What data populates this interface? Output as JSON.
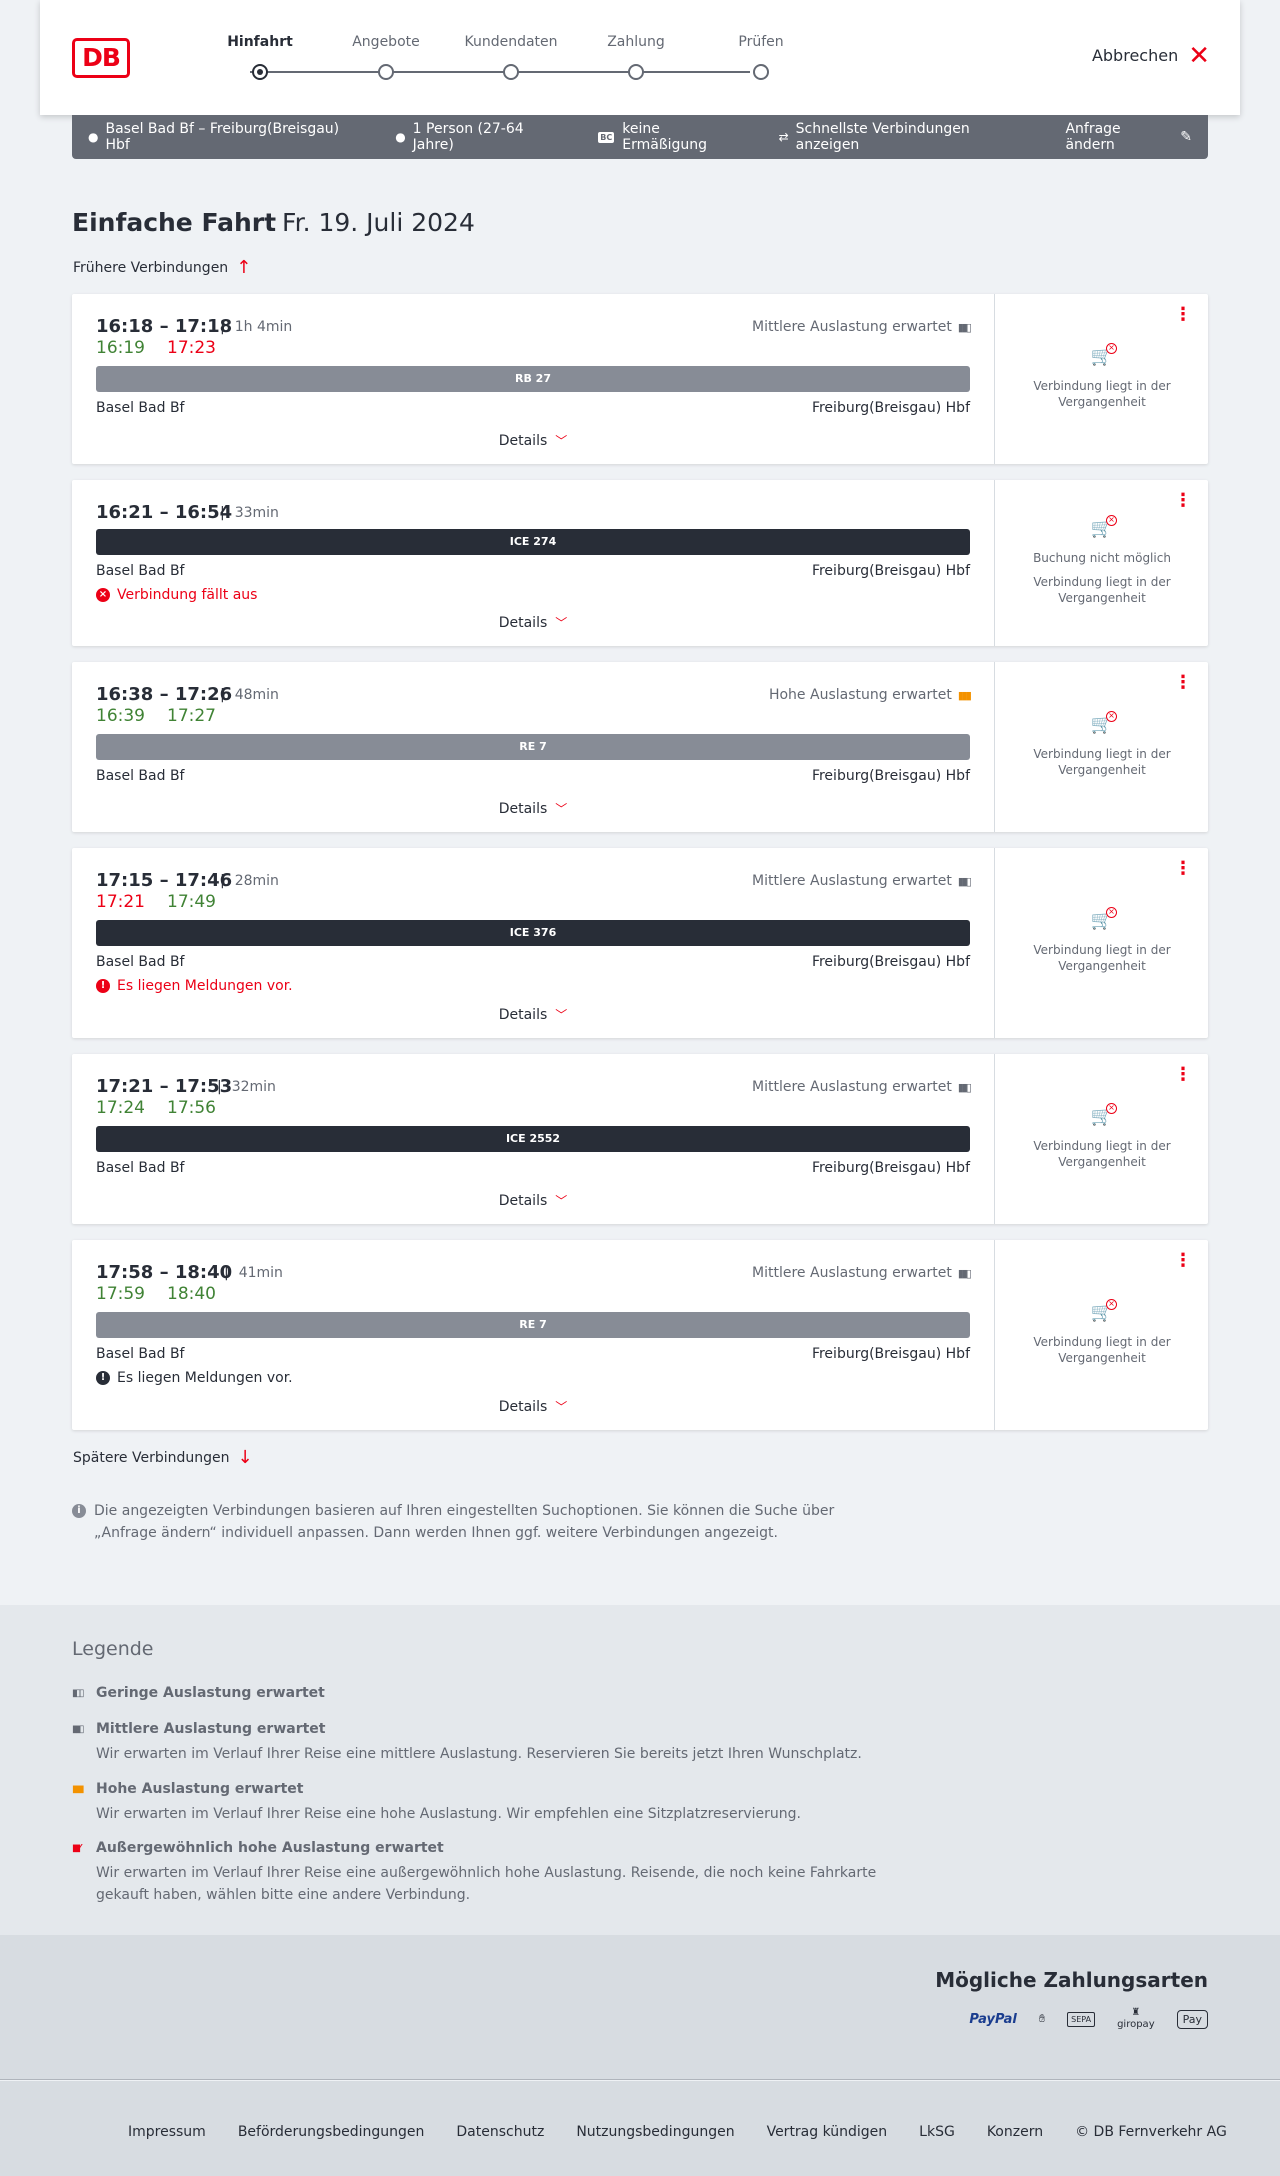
{
  "header": {
    "logo": "DB",
    "steps": [
      {
        "label": "Hinfahrt",
        "active": true
      },
      {
        "label": "Angebote",
        "active": false
      },
      {
        "label": "Kundendaten",
        "active": false
      },
      {
        "label": "Zahlung",
        "active": false
      },
      {
        "label": "Prüfen",
        "active": false
      }
    ],
    "cancel_label": "Abbrechen"
  },
  "searchbar": {
    "route": "Basel Bad Bf – Freiburg(Breisgau) Hbf",
    "travellers": "1 Person (27-64 Jahre)",
    "discount_badge": "BC",
    "discount": "keine Ermäßigung",
    "option": "Schnellste Verbindungen anzeigen",
    "edit_label": "Anfrage ändern"
  },
  "title": {
    "main": "Einfache Fahrt",
    "date": "Fr. 19. Juli 2024"
  },
  "earlier_label": "Frühere Verbindungen",
  "later_label": "Spätere Verbindungen",
  "connections": [
    {
      "times": "16:18 – 17:18",
      "duration": "1h 4min",
      "rt_dep": "16:19",
      "rt_dep_color": "green",
      "rt_arr": "17:23",
      "rt_arr_color": "red",
      "load": "Mittlere Auslastung erwartet",
      "load_level": "medium",
      "train": "RB 27",
      "train_style": "grey",
      "from": "Basel Bad Bf",
      "to": "Freiburg(Breisgau) Hbf",
      "message": "",
      "details": "Details",
      "side": [
        "Verbindung liegt in der Vergangenheit"
      ]
    },
    {
      "times": "16:21 – 16:54",
      "duration": "33min",
      "rt_dep": "",
      "rt_arr": "",
      "load": "",
      "load_level": "",
      "train": "ICE 274",
      "train_style": "dark",
      "from": "Basel Bad Bf",
      "to": "Freiburg(Breisgau) Hbf",
      "message": "Verbindung fällt aus",
      "message_style": "red-x",
      "details": "Details",
      "side": [
        "Buchung nicht möglich",
        "Verbindung liegt in der Vergangenheit"
      ]
    },
    {
      "times": "16:38 – 17:26",
      "duration": "48min",
      "rt_dep": "16:39",
      "rt_dep_color": "green",
      "rt_arr": "17:27",
      "rt_arr_color": "green",
      "load": "Hohe Auslastung erwartet",
      "load_level": "high",
      "train": "RE 7",
      "train_style": "grey",
      "from": "Basel Bad Bf",
      "to": "Freiburg(Breisgau) Hbf",
      "message": "",
      "details": "Details",
      "side": [
        "Verbindung liegt in der Vergangenheit"
      ]
    },
    {
      "times": "17:15 – 17:46",
      "duration": "28min",
      "rt_dep": "17:21",
      "rt_dep_color": "red",
      "rt_arr": "17:49",
      "rt_arr_color": "green",
      "load": "Mittlere Auslastung erwartet",
      "load_level": "medium",
      "train": "ICE 376",
      "train_style": "dark",
      "from": "Basel Bad Bf",
      "to": "Freiburg(Breisgau) Hbf",
      "message": "Es liegen Meldungen vor.",
      "message_style": "red-excl",
      "details": "Details",
      "side": [
        "Verbindung liegt in der Vergangenheit"
      ]
    },
    {
      "times": "17:21 – 17:53",
      "duration": "32min",
      "rt_dep": "17:24",
      "rt_dep_color": "green",
      "rt_arr": "17:56",
      "rt_arr_color": "green",
      "load": "Mittlere Auslastung erwartet",
      "load_level": "medium",
      "train": "ICE 2552",
      "train_style": "dark",
      "from": "Basel Bad Bf",
      "to": "Freiburg(Breisgau) Hbf",
      "message": "",
      "details": "Details",
      "side": [
        "Verbindung liegt in der Vergangenheit"
      ]
    },
    {
      "times": "17:58 – 18:40",
      "duration": "41min",
      "rt_dep": "17:59",
      "rt_dep_color": "green",
      "rt_arr": "18:40",
      "rt_arr_color": "green",
      "load": "Mittlere Auslastung erwartet",
      "load_level": "medium",
      "train": "RE 7",
      "train_style": "grey",
      "from": "Basel Bad Bf",
      "to": "Freiburg(Breisgau) Hbf",
      "message": "Es liegen Meldungen vor.",
      "message_style": "black-excl",
      "details": "Details",
      "side": [
        "Verbindung liegt in der Vergangenheit"
      ]
    }
  ],
  "info_text": "Die angezeigten Verbindungen basieren auf Ihren eingestellten Suchoptionen. Sie können die Suche über „Anfrage ändern“ individuell anpassen. Dann werden Ihnen ggf. weitere Verbindungen angezeigt.",
  "legend": {
    "title": "Legende",
    "items": [
      {
        "label": "Geringe Auslastung erwartet",
        "desc": "",
        "level": "low"
      },
      {
        "label": "Mittlere Auslastung erwartet",
        "desc": "Wir erwarten im Verlauf Ihrer Reise eine mittlere Auslastung. Reservieren Sie bereits jetzt Ihren Wunschplatz.",
        "level": "medium"
      },
      {
        "label": "Hohe Auslastung erwartet",
        "desc": "Wir erwarten im Verlauf Ihrer Reise eine hohe Auslastung. Wir empfehlen eine Sitzplatzreservierung.",
        "level": "high"
      },
      {
        "label": "Außergewöhnlich hohe Auslastung erwartet",
        "desc": "Wir erwarten im Verlauf Ihrer Reise eine außergewöhnlich hohe Auslastung. Reisende, die noch keine Fahrkarte gekauft haben, wählen bitte eine andere Verbindung.",
        "level": "extreme"
      }
    ]
  },
  "payments": {
    "title": "Mögliche Zahlungsarten",
    "methods": [
      "PayPal",
      "card-icon",
      "SEPA",
      "giropay",
      "Pay"
    ]
  },
  "footer": {
    "links": [
      "Impressum",
      "Beförderungsbedingungen",
      "Datenschutz",
      "Nutzungsbedingungen",
      "Vertrag kündigen",
      "LkSG",
      "Konzern",
      "© DB Fernverkehr AG"
    ]
  },
  "colors": {
    "db_red": "#ec0016",
    "on_time_green": "#408335",
    "high_load_orange": "#f39200",
    "bar_dark": "#282d37",
    "bar_grey": "#878c96"
  }
}
